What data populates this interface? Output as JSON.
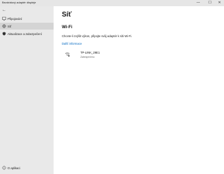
{
  "window": {
    "title": "Bezdrátový adaptér displeje",
    "minimize_glyph": "—",
    "maximize_glyph": "☐",
    "close_glyph": "✕"
  },
  "sidebar": {
    "back_glyph": "←",
    "items": [
      {
        "label": "Připojování",
        "icon": "connect-icon",
        "selected": false
      },
      {
        "label": "Síť",
        "icon": "globe-icon",
        "selected": true
      },
      {
        "label": "Aktualizace a zabezpečení",
        "icon": "shield-icon",
        "selected": false
      }
    ],
    "about": {
      "label": "O aplikaci",
      "icon": "info-icon"
    }
  },
  "main": {
    "title": "Síť",
    "section_title": "Wi-Fi",
    "description": "Chcete-li zvýšit výkon, připojte svůj adaptér k síti Wi-Fi.",
    "more_info_link": "Další informace",
    "networks": [
      {
        "ssid": "TP-LINK_29E1",
        "status": "Zabezpečeno",
        "icon": "wifi-secured-icon"
      }
    ]
  }
}
